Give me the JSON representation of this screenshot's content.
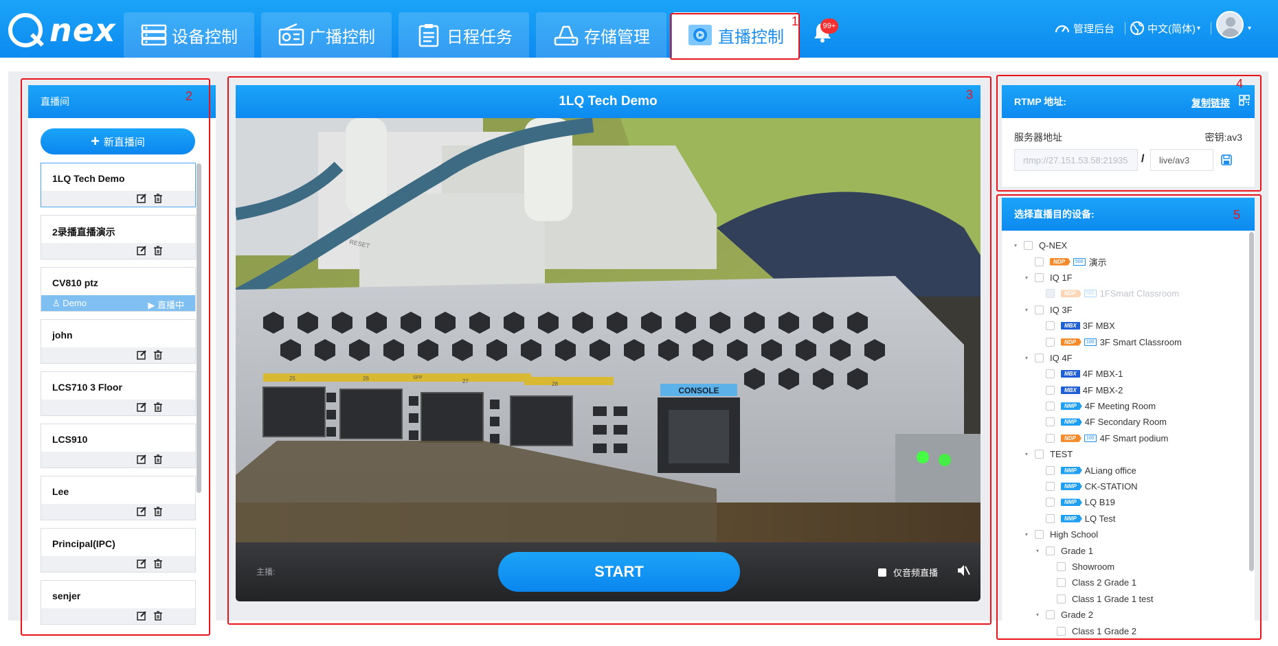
{
  "app": {
    "logo_text": "nex"
  },
  "nav": {
    "tabs": [
      {
        "label": "设备控制",
        "icon": "device-rack-icon"
      },
      {
        "label": "广播控制",
        "icon": "radio-icon"
      },
      {
        "label": "日程任务",
        "icon": "clipboard-icon"
      },
      {
        "label": "存储管理",
        "icon": "cloud-storage-icon"
      },
      {
        "label": "直播控制",
        "icon": "live-camera-icon",
        "active": true
      }
    ],
    "notification_badge": "99+",
    "admin_label": "管理后台",
    "language_label": "中文(简体)",
    "language_caret": "▾",
    "user_caret": "▾"
  },
  "annotations": [
    "1",
    "2",
    "3",
    "4",
    "5"
  ],
  "left_panel": {
    "title": "直播间",
    "new_room_plus": "+",
    "new_room_label": "新直播间",
    "rooms": [
      {
        "name": "1LQ Tech Demo",
        "selected": true
      },
      {
        "name": "2录播直播演示"
      },
      {
        "name": "CV810 ptz",
        "live": true,
        "host": "Demo",
        "host_prefix": "♙ ",
        "status": "直播中",
        "status_prefix": "▶ "
      },
      {
        "name": "john"
      },
      {
        "name": "LCS710 3 Floor"
      },
      {
        "name": "LCS910"
      },
      {
        "name": "Lee"
      },
      {
        "name": "Principal(IPC)"
      },
      {
        "name": "senjer"
      }
    ]
  },
  "center": {
    "title": "1LQ Tech Demo",
    "video_labels": {
      "console": "CONSOLE",
      "reset": "RESET",
      "sfp": "SFP",
      "ports": [
        "25",
        "26",
        "27",
        "28"
      ]
    },
    "anchor_label": "主播:",
    "start_label": "START",
    "audio_only_label": "仅音频直播"
  },
  "rtmp": {
    "title": "RTMP 地址:",
    "copy_link": "复制链接",
    "server_label": "服务器地址",
    "key_label": "密钥:av3",
    "server_value": "rtmp://27.151.53.58:21935",
    "slash": "/",
    "key_value": "live/av3"
  },
  "device_panel": {
    "title": "选择直播目的设备:",
    "tree": [
      {
        "level": 0,
        "label": "Q-NEX",
        "expanded": true
      },
      {
        "level": 1,
        "label": "演示",
        "tag": "NDP",
        "count": "500"
      },
      {
        "level": 1,
        "label": "IQ 1F",
        "expanded": true
      },
      {
        "level": 2,
        "label": "1FSmart Classroom",
        "tag": "NDP",
        "count": "500",
        "disabled": true
      },
      {
        "level": 1,
        "label": "IQ 3F",
        "expanded": true
      },
      {
        "level": 2,
        "label": "3F MBX",
        "tag": "MBX"
      },
      {
        "level": 2,
        "label": "3F Smart Classroom",
        "tag": "NDP",
        "count": "100"
      },
      {
        "level": 1,
        "label": "IQ 4F",
        "expanded": true
      },
      {
        "level": 2,
        "label": "4F MBX-1",
        "tag": "MBX"
      },
      {
        "level": 2,
        "label": "4F MBX-2",
        "tag": "MBX"
      },
      {
        "level": 2,
        "label": "4F Meeting Room",
        "tag": "NMP"
      },
      {
        "level": 2,
        "label": "4F Secondary Room",
        "tag": "NMP"
      },
      {
        "level": 2,
        "label": "4F Smart podium",
        "tag": "NDP",
        "count": "100"
      },
      {
        "level": 1,
        "label": "TEST",
        "expanded": true
      },
      {
        "level": 2,
        "label": "ALiang office",
        "tag": "NMP"
      },
      {
        "level": 2,
        "label": "CK-STATION",
        "tag": "NMP"
      },
      {
        "level": 2,
        "label": "LQ B19",
        "tag": "NMP"
      },
      {
        "level": 2,
        "label": "LQ Test",
        "tag": "NMP"
      },
      {
        "level": 1,
        "label": "High School",
        "expanded": true
      },
      {
        "level": 2,
        "label": "Grade 1",
        "expanded": true
      },
      {
        "level": 3,
        "label": "Showroom"
      },
      {
        "level": 3,
        "label": "Class 2 Grade 1"
      },
      {
        "level": 3,
        "label": "Class 1 Grade 1 test"
      },
      {
        "level": 2,
        "label": "Grade 2",
        "expanded": true
      },
      {
        "level": 3,
        "label": "Class 1 Grade 2"
      }
    ]
  },
  "colors": {
    "brand_blue": "#0d8af0",
    "annotation_red": "#e8141a",
    "live_bar": "#7fbff1",
    "badge_red": "#f23030"
  }
}
